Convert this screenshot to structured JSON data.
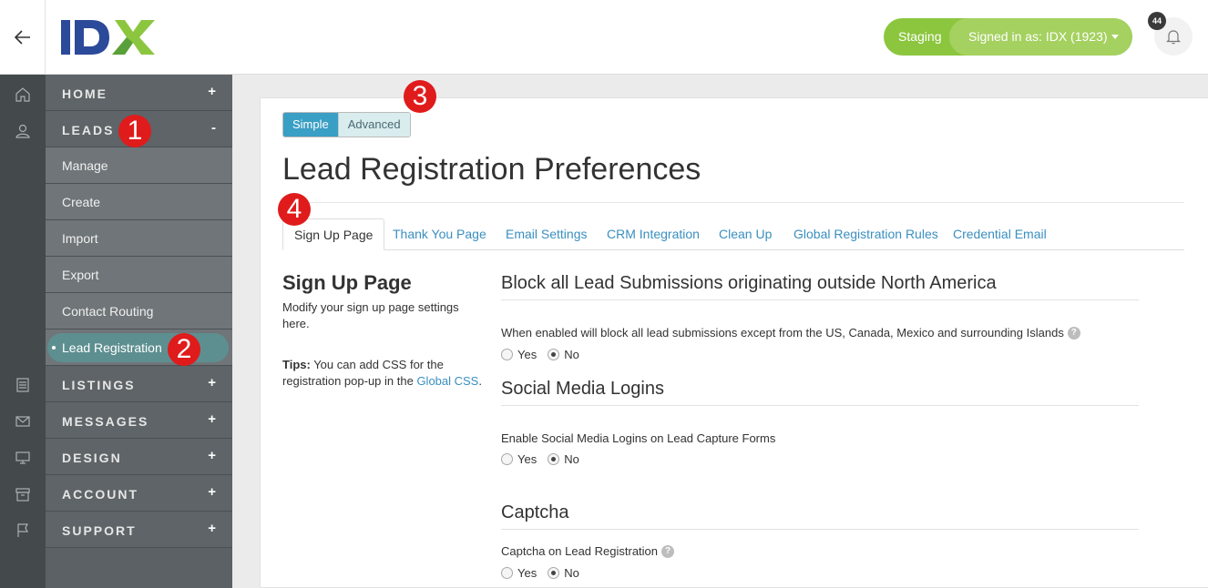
{
  "header": {
    "logo_text": "IDX",
    "env_label": "Staging",
    "signed_in_label": "Signed in as: IDX (1923)",
    "notification_count": "44"
  },
  "sidebar": {
    "sections": [
      {
        "label": "HOME",
        "toggle": "+"
      },
      {
        "label": "LEADS",
        "toggle": "-"
      },
      {
        "label": "LISTINGS",
        "toggle": "+"
      },
      {
        "label": "MESSAGES",
        "toggle": "+"
      },
      {
        "label": "DESIGN",
        "toggle": "+"
      },
      {
        "label": "ACCOUNT",
        "toggle": "+"
      },
      {
        "label": "SUPPORT",
        "toggle": "+"
      }
    ],
    "leads_items": [
      "Manage",
      "Create",
      "Import",
      "Export",
      "Contact Routing",
      "Lead Registration"
    ],
    "active_item": "Lead Registration"
  },
  "markers": [
    "1",
    "2",
    "3",
    "4"
  ],
  "main": {
    "mode_toggle": {
      "simple": "Simple",
      "advanced": "Advanced",
      "selected": "Simple"
    },
    "page_title": "Lead Registration Preferences",
    "tabs": [
      "Sign Up Page",
      "Thank You Page",
      "Email Settings",
      "CRM Integration",
      "Clean Up",
      "Global Registration Rules",
      "Credential Email"
    ],
    "active_tab": "Sign Up Page",
    "side": {
      "title": "Sign Up Page",
      "description": "Modify your sign up page settings here.",
      "tips_label": "Tips:",
      "tips_text": " You can add CSS for the registration pop-up in the ",
      "tips_link": "Global CSS",
      "tips_end": "."
    },
    "sections": [
      {
        "title": "Block all Lead Submissions originating outside North America",
        "description": "When enabled will block all lead submissions except from the US, Canada, Mexico and surrounding Islands",
        "has_help": true,
        "yes_label": "Yes",
        "no_label": "No",
        "selected": "No"
      },
      {
        "title": "Social Media Logins",
        "description": "Enable Social Media Logins on Lead Capture Forms",
        "has_help": false,
        "yes_label": "Yes",
        "no_label": "No",
        "selected": "No"
      },
      {
        "title": "Captcha",
        "description": "Captcha on Lead Registration",
        "has_help": true,
        "yes_label": "Yes",
        "no_label": "No",
        "selected": "No"
      }
    ]
  }
}
